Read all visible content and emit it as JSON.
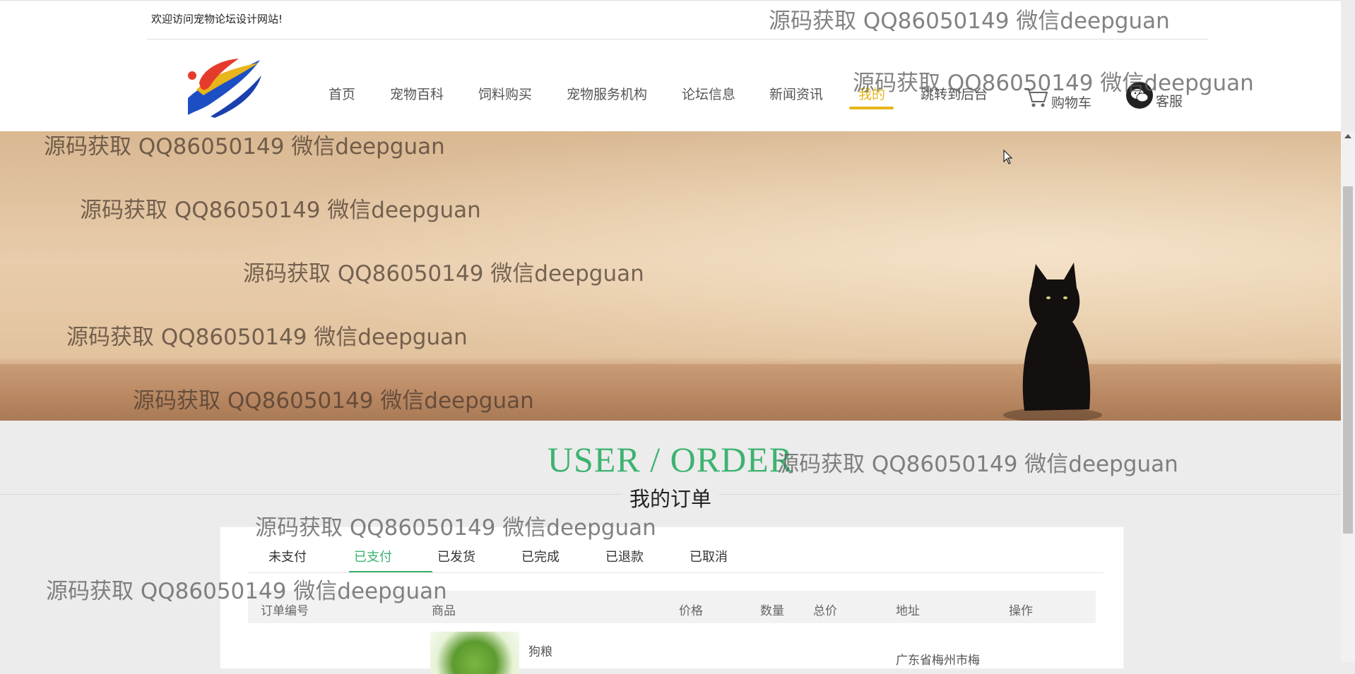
{
  "header": {
    "welcome": "欢迎访问宠物论坛设计网站!",
    "nav": [
      "首页",
      "宠物百科",
      "饲料购买",
      "宠物服务机构",
      "论坛信息",
      "新闻资讯",
      "我的",
      "跳转到后台"
    ],
    "active_nav": "我的",
    "cart_label": "购物车",
    "service_label": "客服",
    "accent_color": "#e8b51b"
  },
  "section": {
    "title_en": "USER / ORDER",
    "title_cn": "我的订单",
    "title_color": "#3cb371"
  },
  "orders": {
    "tabs": [
      "未支付",
      "已支付",
      "已发货",
      "已完成",
      "已退款",
      "已取消"
    ],
    "active_tab": "已支付",
    "columns": [
      "订单编号",
      "商品",
      "价格",
      "数量",
      "总价",
      "地址",
      "操作"
    ],
    "rows": [
      {
        "product_name": "狗粮",
        "address": "广东省梅州市梅"
      }
    ]
  },
  "watermark_text": "源码获取 QQ86050149 微信deepguan"
}
